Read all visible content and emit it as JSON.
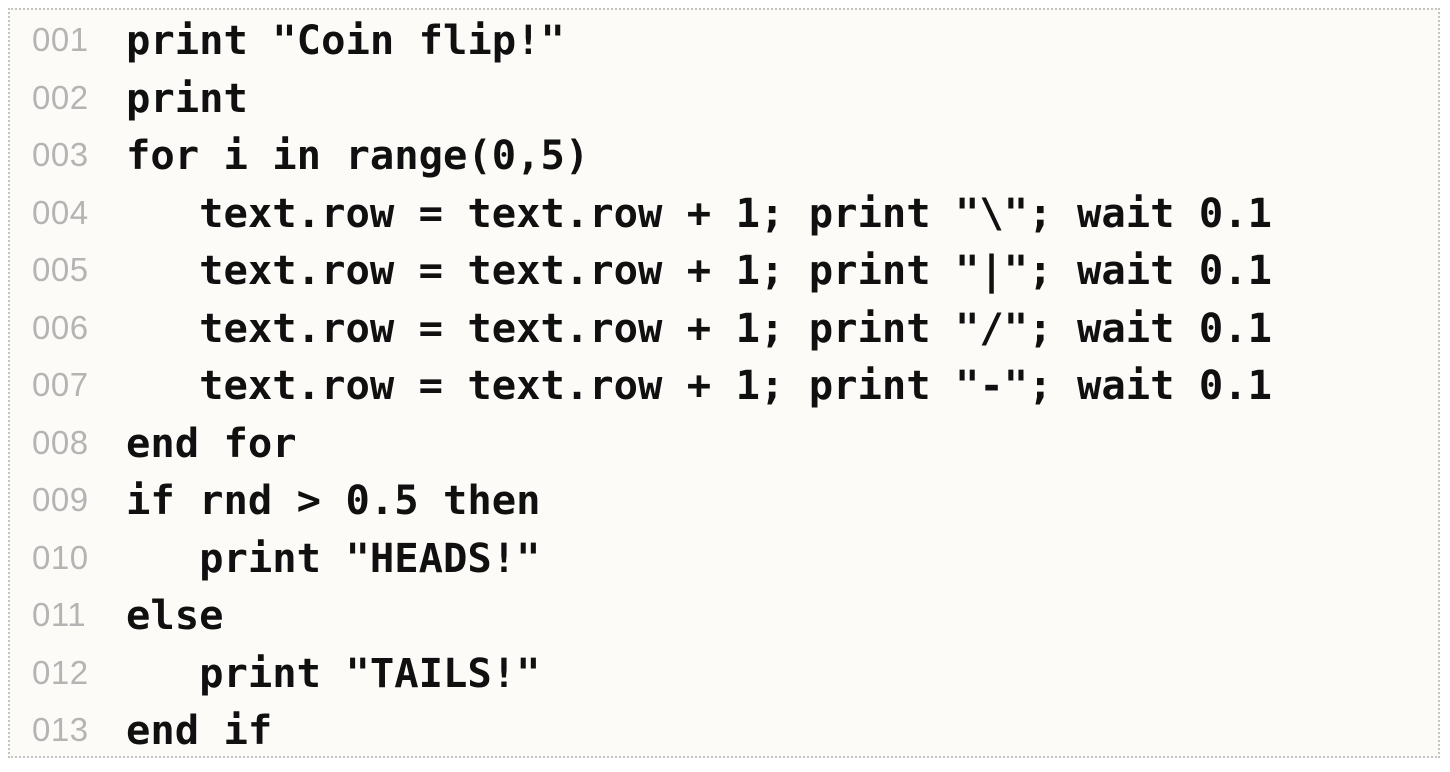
{
  "code": {
    "lines": [
      {
        "number": "001",
        "text": "print \"Coin flip!\""
      },
      {
        "number": "002",
        "text": "print"
      },
      {
        "number": "003",
        "text": "for i in range(0,5)"
      },
      {
        "number": "004",
        "text": "   text.row = text.row + 1; print \"\\\"; wait 0.1"
      },
      {
        "number": "005",
        "text": "   text.row = text.row + 1; print \"|\"; wait 0.1"
      },
      {
        "number": "006",
        "text": "   text.row = text.row + 1; print \"/\"; wait 0.1"
      },
      {
        "number": "007",
        "text": "   text.row = text.row + 1; print \"-\"; wait 0.1"
      },
      {
        "number": "008",
        "text": "end for"
      },
      {
        "number": "009",
        "text": "if rnd > 0.5 then"
      },
      {
        "number": "010",
        "text": "   print \"HEADS!\""
      },
      {
        "number": "011",
        "text": "else"
      },
      {
        "number": "012",
        "text": "   print \"TAILS!\""
      },
      {
        "number": "013",
        "text": "end if"
      }
    ]
  }
}
